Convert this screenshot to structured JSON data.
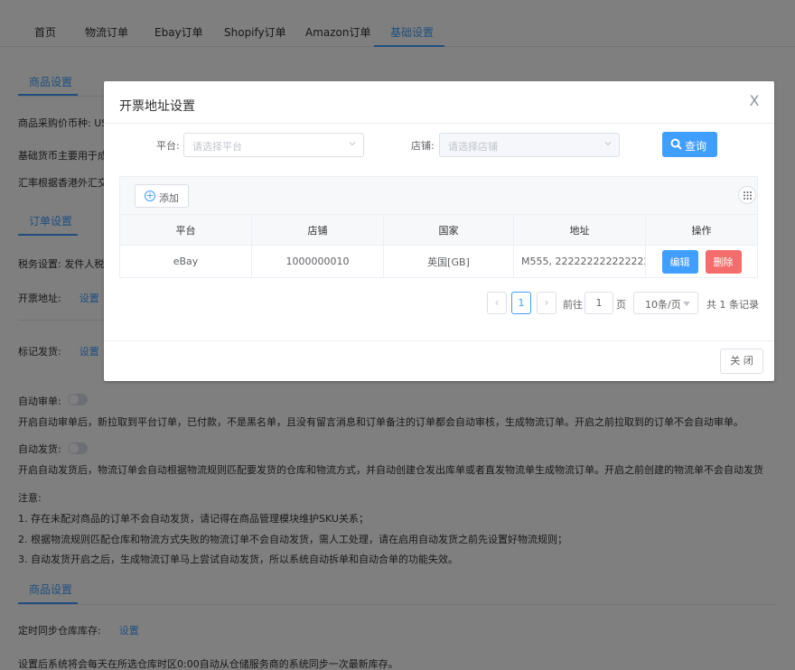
{
  "nav": {
    "tabs": [
      "首页",
      "物流订单",
      "Ebay订单",
      "Shopify订单",
      "Amazon订单",
      "基础设置"
    ],
    "active_index": 5
  },
  "page": {
    "section1_tab": "商品设置",
    "currency_line": "商品采购价币种: US",
    "base_currency_line": "基础货币主要用于成",
    "exchange_line": "汇率根据香港外汇交",
    "section2_tab": "订单设置",
    "tax_line": "税务设置: 发件人税",
    "invoice_label": "开票地址:",
    "invoice_link": "设置",
    "mark_label": "标记发货:",
    "mark_link": "设置",
    "auto_review_label": "自动审单:",
    "auto_review_desc": "开启自动审单后，新拉取到平台订单，已付款，不是黑名单，且没有留言消息和订单备注的订单都会自动审核，生成物流订单。开启之前拉取到的订单不会自动审单。",
    "auto_ship_label": "自动发货:",
    "auto_ship_desc": "开启自动发货后，物流订单会自动根据物流规则匹配要发货的仓库和物流方式，并自动创建仓发出库单或者直发物流单生成物流订单。开启之前创建的物流单不会自动发货",
    "notes_title": "注意:",
    "notes": [
      "1. 存在未配对商品的订单不会自动发货，请记得在商品管理模块维护SKU关系；",
      "2. 根据物流规则匹配仓库和物流方式失败的物流订单不会自动发货，需人工处理，请在启用自动发货之前先设置好物流规则；",
      "3. 自动发货开启之后，生成物流订单马上尝试自动发货，所以系统自动拆单和自动合单的功能失效。"
    ],
    "section3_tab": "商品设置",
    "sync_label": "定时同步仓库库存:",
    "sync_link": "设置",
    "sync_desc": "设置后系统将会每天在所选仓库时区0:00自动从仓储服务商的系统同步一次最新库存。"
  },
  "dialog": {
    "title": "开票地址设置",
    "close_icon": "X",
    "platform_label": "平台:",
    "platform_placeholder": "请选择平台",
    "store_label": "店铺:",
    "store_placeholder": "请选择店铺",
    "query_button": "查询",
    "add_button": "添加",
    "columns": [
      "平台",
      "店铺",
      "国家",
      "地址",
      "操作"
    ],
    "rows": [
      {
        "platform": "eBay",
        "store": "1000000010",
        "country": "英国[GB]",
        "address": "M555, 2222222222222222,..."
      }
    ],
    "edit_button": "编辑",
    "delete_button": "删除",
    "pagination": {
      "current_page": "1",
      "goto_prefix": "前往",
      "goto_value": "1",
      "goto_suffix": "页",
      "page_size": "10条/页",
      "total": "共 1 条记录"
    },
    "footer_close": "关 闭"
  },
  "colors": {
    "primary": "#409eff",
    "danger": "#f56c6c",
    "border": "#dcdfe6"
  }
}
